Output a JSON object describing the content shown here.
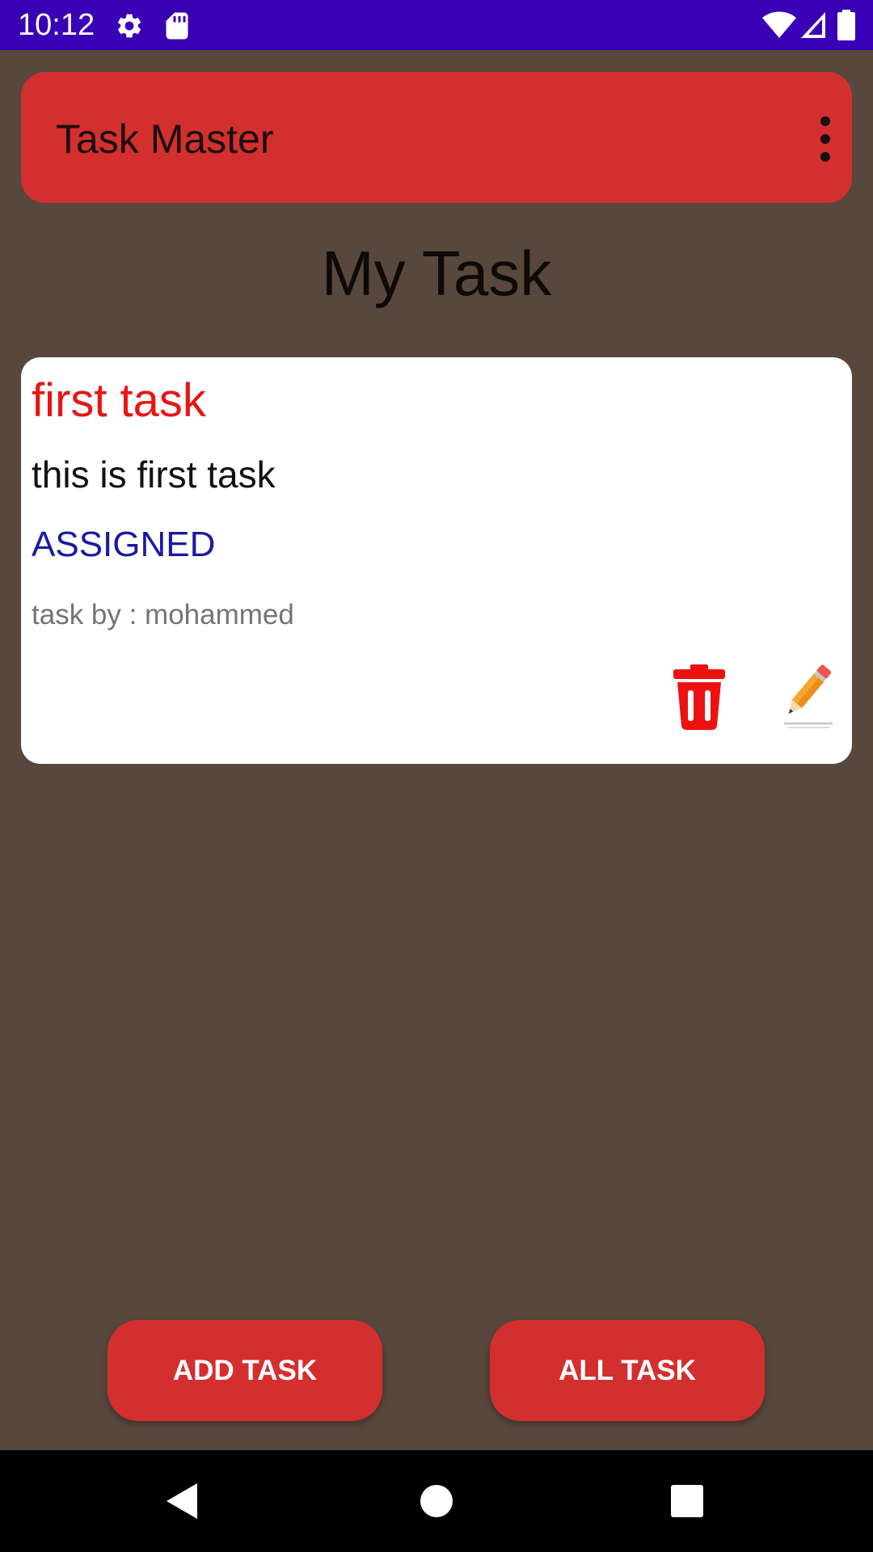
{
  "status_bar": {
    "time": "10:12",
    "icons": [
      "settings-icon",
      "sd-card-icon",
      "wifi-icon",
      "signal-icon",
      "battery-icon"
    ]
  },
  "app_bar": {
    "title": "Task Master",
    "menu_icon": "more-vertical-icon"
  },
  "page": {
    "title": "My Task"
  },
  "tasks": [
    {
      "title": "first task",
      "body": "this is first task",
      "state": "ASSIGNED",
      "author": "task by : mohammed",
      "actions": [
        "trash-icon",
        "pencil-icon"
      ]
    }
  ],
  "buttons": {
    "add_task": "ADD TASK",
    "all_task": "ALL TASK"
  },
  "nav_bar": {
    "icons": [
      "back-icon",
      "home-icon",
      "recents-icon"
    ]
  },
  "colors": {
    "background": "#58473c",
    "status_bar": "#3a00b6",
    "accent": "#d32f2f",
    "task_title": "#e81515",
    "task_state": "#1a1aa3",
    "task_author": "#747474"
  }
}
